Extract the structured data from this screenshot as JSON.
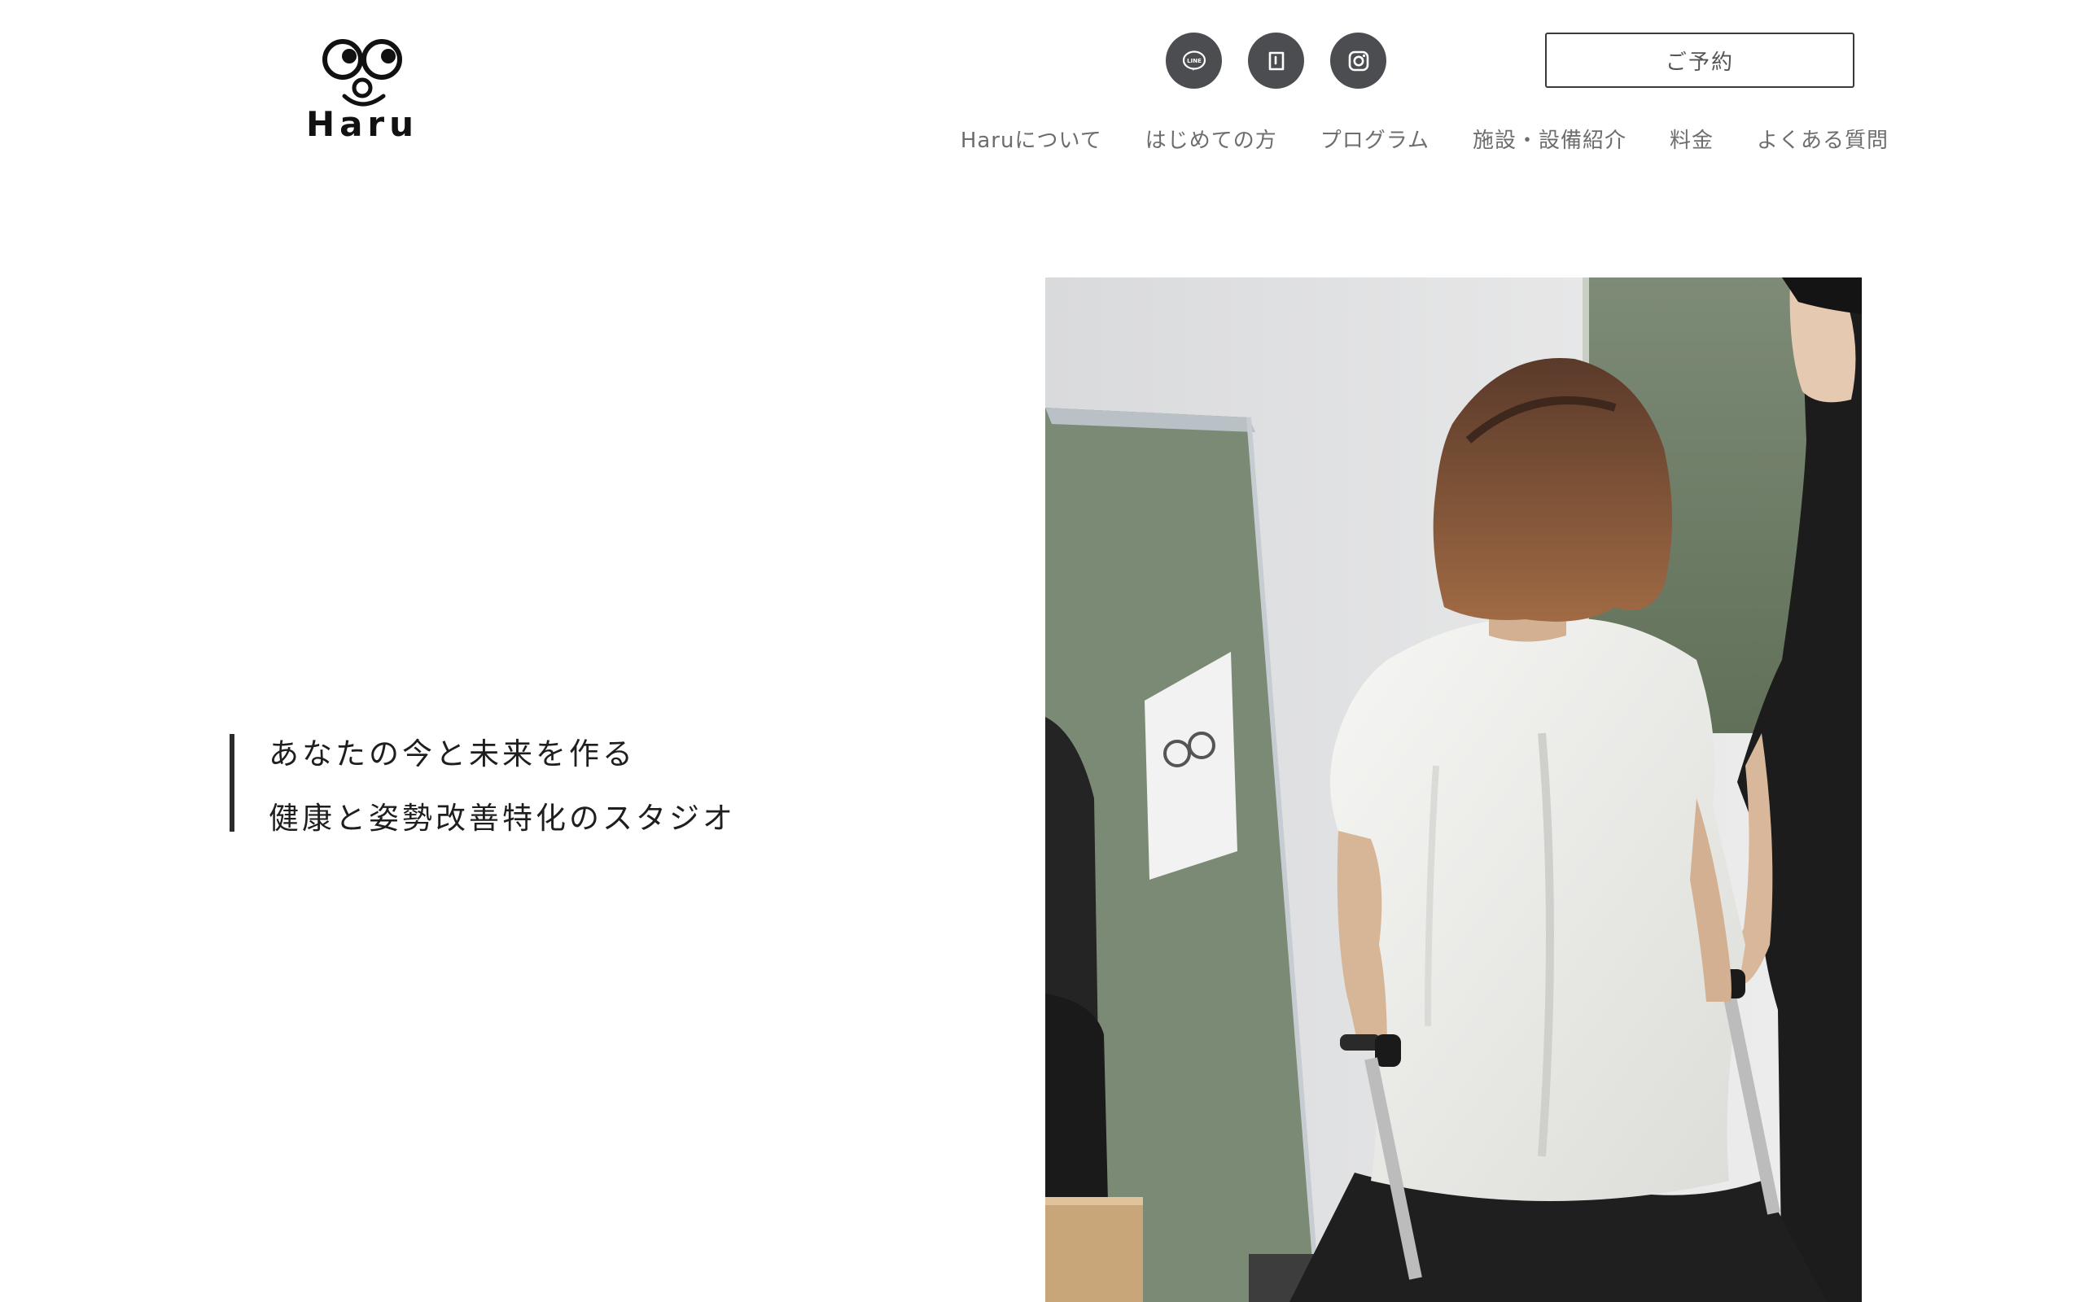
{
  "header": {
    "logo_text": "Haru",
    "reserve_label": "ご予約",
    "social": [
      {
        "name": "line-icon",
        "icon_text": "LINE"
      },
      {
        "name": "note-icon"
      },
      {
        "name": "instagram-icon"
      }
    ]
  },
  "nav": {
    "items": [
      {
        "label": "Haruについて"
      },
      {
        "label": "はじめての方"
      },
      {
        "label": "プログラム"
      },
      {
        "label": "施設・設備紹介"
      },
      {
        "label": "料金"
      },
      {
        "label": "よくある質問"
      }
    ]
  },
  "hero": {
    "line1": "あなたの今と未来を作る",
    "line2": "健康と姿勢改善特化のスタジオ"
  },
  "colors": {
    "icon_circle": "#4b4d50",
    "text_dark": "#1e1e1e",
    "nav_text": "#6d6d6d",
    "wall_green": "#6f7f69"
  }
}
